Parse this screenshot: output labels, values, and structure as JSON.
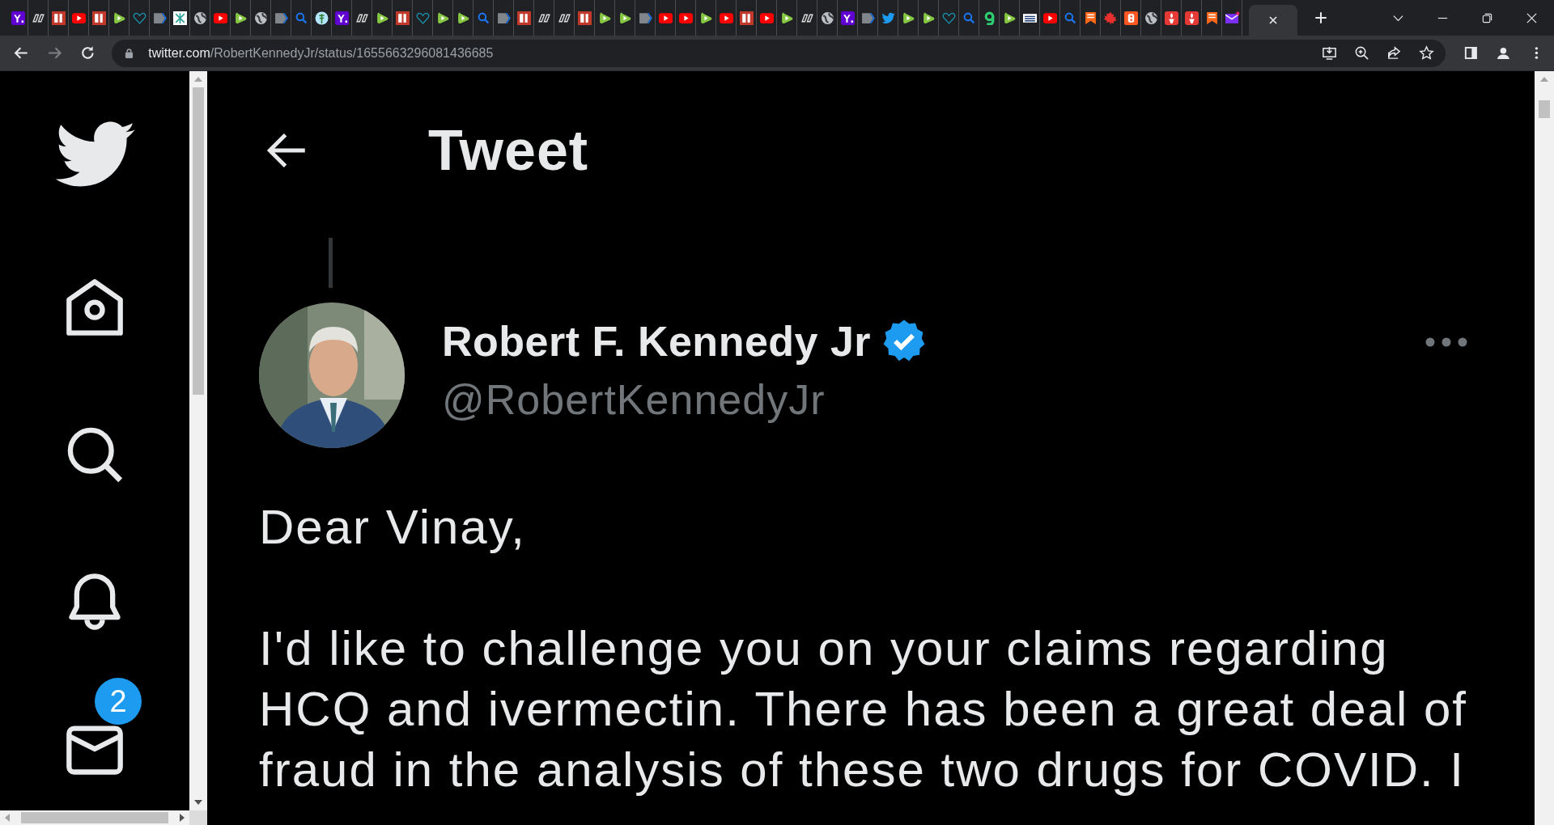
{
  "browser": {
    "tabs": [
      {
        "kind": "yahoo",
        "selected": false
      },
      {
        "kind": "dr",
        "selected": false
      },
      {
        "kind": "bi",
        "selected": false
      },
      {
        "kind": "youtube",
        "selected": false
      },
      {
        "kind": "bi",
        "selected": false
      },
      {
        "kind": "rumble",
        "selected": false
      },
      {
        "kind": "heart",
        "selected": false
      },
      {
        "kind": "flag",
        "selected": false
      },
      {
        "kind": "grid",
        "selected": false
      },
      {
        "kind": "globe",
        "selected": false
      },
      {
        "kind": "youtube",
        "selected": false
      },
      {
        "kind": "rumble",
        "selected": false
      },
      {
        "kind": "globe",
        "selected": false
      },
      {
        "kind": "flag",
        "selected": false
      },
      {
        "kind": "search",
        "selected": false
      },
      {
        "kind": "tree",
        "selected": false
      },
      {
        "kind": "yahoo",
        "selected": false
      },
      {
        "kind": "dr",
        "selected": false
      },
      {
        "kind": "rumble",
        "selected": false
      },
      {
        "kind": "bi",
        "selected": false
      },
      {
        "kind": "heart",
        "selected": false
      },
      {
        "kind": "rumble",
        "selected": false
      },
      {
        "kind": "rumble",
        "selected": false
      },
      {
        "kind": "search",
        "selected": false
      },
      {
        "kind": "flag",
        "selected": false
      },
      {
        "kind": "bi",
        "selected": false
      },
      {
        "kind": "dr",
        "selected": false
      },
      {
        "kind": "dr",
        "selected": false
      },
      {
        "kind": "bi",
        "selected": false
      },
      {
        "kind": "rumble",
        "selected": false
      },
      {
        "kind": "rumble",
        "selected": false
      },
      {
        "kind": "flag",
        "selected": false
      },
      {
        "kind": "youtube",
        "selected": false
      },
      {
        "kind": "youtube",
        "selected": false
      },
      {
        "kind": "rumble",
        "selected": false
      },
      {
        "kind": "youtube",
        "selected": false
      },
      {
        "kind": "bi",
        "selected": false
      },
      {
        "kind": "youtube",
        "selected": false
      },
      {
        "kind": "rumble",
        "selected": false
      },
      {
        "kind": "dr",
        "selected": false
      },
      {
        "kind": "globe",
        "selected": false
      },
      {
        "kind": "yahoo",
        "selected": false
      },
      {
        "kind": "flag",
        "selected": false
      },
      {
        "kind": "twitter",
        "selected": false
      },
      {
        "kind": "rumble",
        "selected": false
      },
      {
        "kind": "rumble",
        "selected": false
      },
      {
        "kind": "heart",
        "selected": false
      },
      {
        "kind": "search",
        "selected": false
      },
      {
        "kind": "g",
        "selected": false
      },
      {
        "kind": "rumble",
        "selected": false
      },
      {
        "kind": "news",
        "selected": false
      },
      {
        "kind": "youtube",
        "selected": false
      },
      {
        "kind": "search",
        "selected": false
      },
      {
        "kind": "banner",
        "selected": false
      },
      {
        "kind": "maple",
        "selected": false
      },
      {
        "kind": "b",
        "selected": false
      },
      {
        "kind": "globe",
        "selected": false
      },
      {
        "kind": "torch",
        "selected": false
      },
      {
        "kind": "torch",
        "selected": false
      },
      {
        "kind": "banner",
        "selected": false
      },
      {
        "kind": "mail",
        "selected": false
      },
      {
        "selected": true
      }
    ],
    "nav": [
      {
        "kind": "back",
        "disabled": false
      },
      {
        "kind": "forward",
        "disabled": true
      },
      {
        "kind": "reload",
        "disabled": false
      }
    ],
    "url": {
      "host": "twitter.com",
      "path": "/RobertKennedyJr/status/1655663296081436685"
    }
  },
  "sidebar": {
    "messages_badge": "2"
  },
  "header": {
    "title": "Tweet"
  },
  "tweet": {
    "name": "Robert F. Kennedy Jr",
    "verified": true,
    "handle": "@RobertKennedyJr",
    "paragraphs": [
      "Dear Vinay,",
      "I'd like to challenge you on your claims regarding HCQ and ivermectin. There has been a great deal of fraud in the analysis of these two drugs for COVID. I"
    ]
  }
}
